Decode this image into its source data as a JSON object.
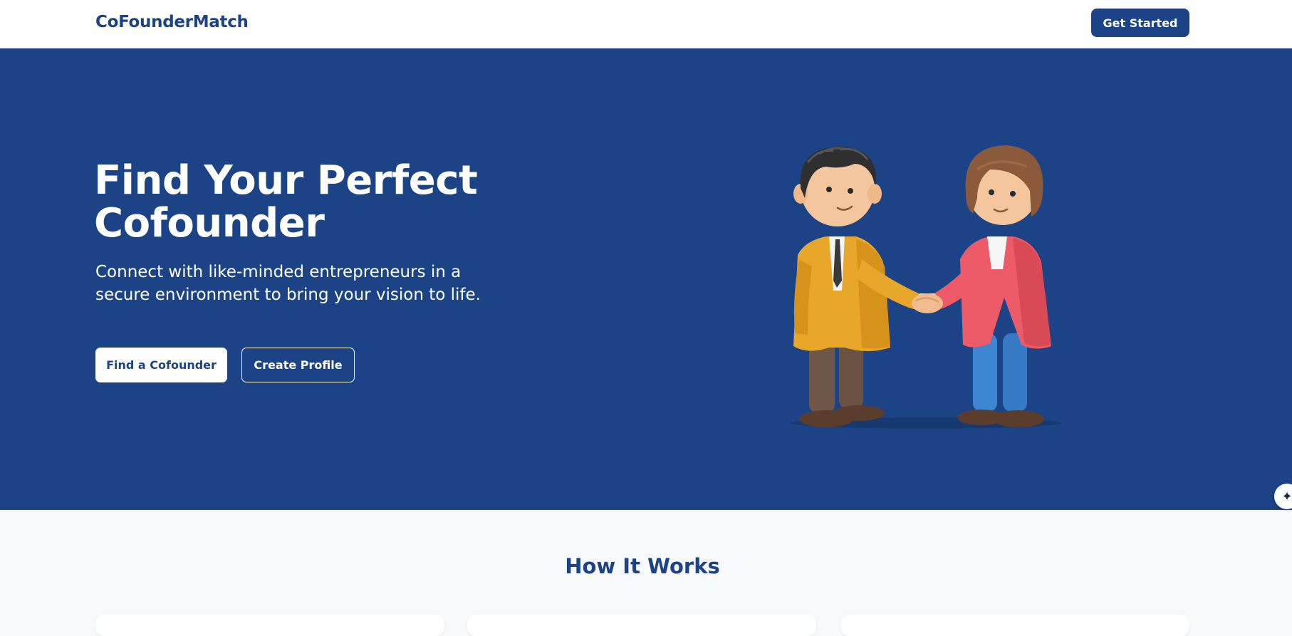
{
  "header": {
    "brand": "CoFounderMatch",
    "cta_label": "Get Started"
  },
  "hero": {
    "title": "Find Your Perfect Cofounder",
    "subtitle": "Connect with like-minded entrepreneurs in a secure environment to bring your vision to life.",
    "primary_button": "Find a Cofounder",
    "secondary_button": "Create Profile",
    "illustration": "handshake-illustration"
  },
  "floating_button": {
    "icon": "sparkle-icon"
  },
  "how_it_works": {
    "title": "How It Works"
  },
  "colors": {
    "brand": "#1c4385",
    "background": "#f8f9fb",
    "white": "#ffffff"
  }
}
